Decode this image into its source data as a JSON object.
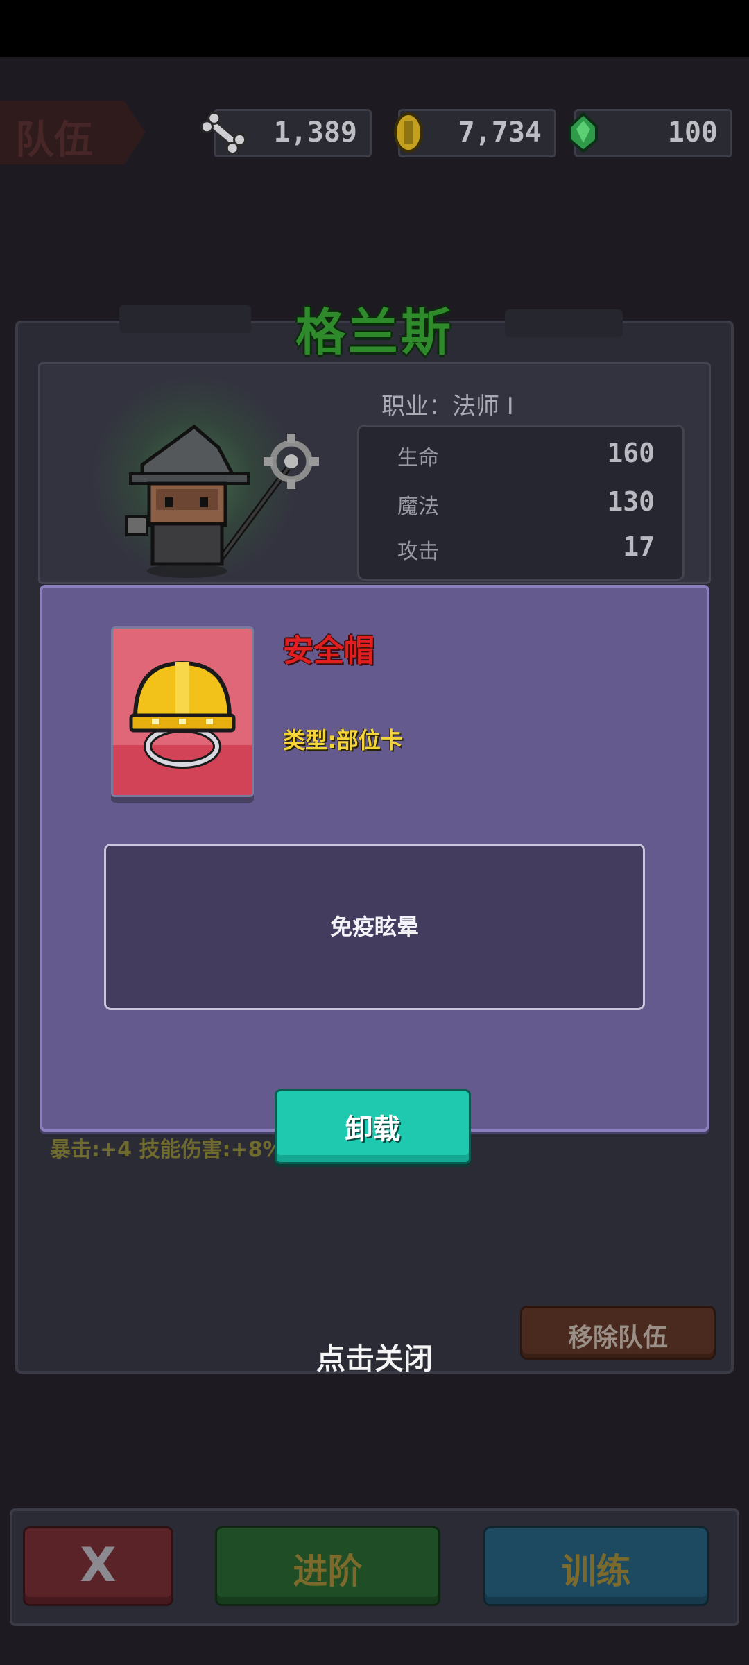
{
  "header": {
    "team_tab_label": "队伍",
    "resources": [
      {
        "icon": "bone-icon",
        "value": "1,389"
      },
      {
        "icon": "gold-coin-icon",
        "value": "7,734"
      },
      {
        "icon": "green-gem-icon",
        "value": "100"
      }
    ]
  },
  "hero": {
    "name": "格兰斯",
    "job": "职业：法师 I",
    "stats": [
      {
        "label": "生命",
        "value": "160"
      },
      {
        "label": "魔法",
        "value": "130"
      },
      {
        "label": "攻击",
        "value": "17"
      }
    ],
    "bonus": "暴击:+4  技能伤害:+8%",
    "remove_label": "移除队伍"
  },
  "modal": {
    "item_name": "安全帽",
    "item_type": "类型:部位卡",
    "item_icon": "hard-hat-icon",
    "description": "免疫眩晕",
    "unload_label": "卸载"
  },
  "close_hint": "点击关闭",
  "bottom_bar": {
    "close_label": "X",
    "advance_label": "进阶",
    "train_label": "训练"
  },
  "colors": {
    "modal_bg": "#645a8e",
    "unload_button": "#1ec9b0",
    "item_name": "#e02020",
    "item_type": "#f4d43a"
  }
}
